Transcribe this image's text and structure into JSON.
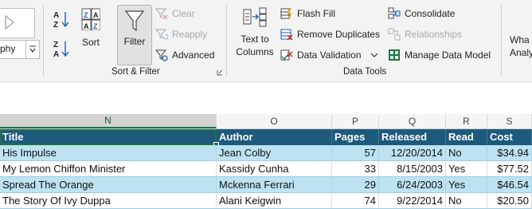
{
  "ribbon": {
    "partial_style_label": "phy",
    "sort_filter": {
      "sort_label": "Sort",
      "filter_label": "Filter",
      "clear_label": "Clear",
      "reapply_label": "Reapply",
      "advanced_label": "Advanced",
      "group_label": "Sort & Filter"
    },
    "data_tools": {
      "text_to_columns_line1": "Text to",
      "text_to_columns_line2": "Columns",
      "flash_fill_label": "Flash Fill",
      "remove_duplicates_label": "Remove Duplicates",
      "data_validation_label": "Data Validation",
      "consolidate_label": "Consolidate",
      "relationships_label": "Relationships",
      "manage_data_model_label": "Manage Data Model",
      "group_label": "Data Tools"
    },
    "what_if_line1": "Wha",
    "what_if_line2": "Analy"
  },
  "sheet": {
    "columns": [
      "N",
      "O",
      "P",
      "Q",
      "R",
      "S"
    ],
    "selected_column": "N",
    "header": [
      "Title",
      "Author",
      "Pages",
      "Released",
      "Read",
      "Cost"
    ],
    "rows": [
      [
        "His Impulse",
        "Jean Colby",
        "57",
        "12/20/2014",
        "No",
        "$34.94"
      ],
      [
        "My Lemon Chiffon Minister",
        "Kassidy Cunha",
        "33",
        "8/15/2003",
        "Yes",
        "$77.52"
      ],
      [
        "Spread The Orange",
        "Mckenna Ferrari",
        "29",
        "6/24/2003",
        "Yes",
        "$46.54"
      ],
      [
        "The Story Of Ivy Duppa",
        "Alani Keigwin",
        "74",
        "9/22/2014",
        "No",
        "$20.50"
      ]
    ]
  },
  "colors": {
    "header_fill": "#1e5a7c",
    "band_fill": "#bde3f2",
    "selection": "#217346"
  }
}
